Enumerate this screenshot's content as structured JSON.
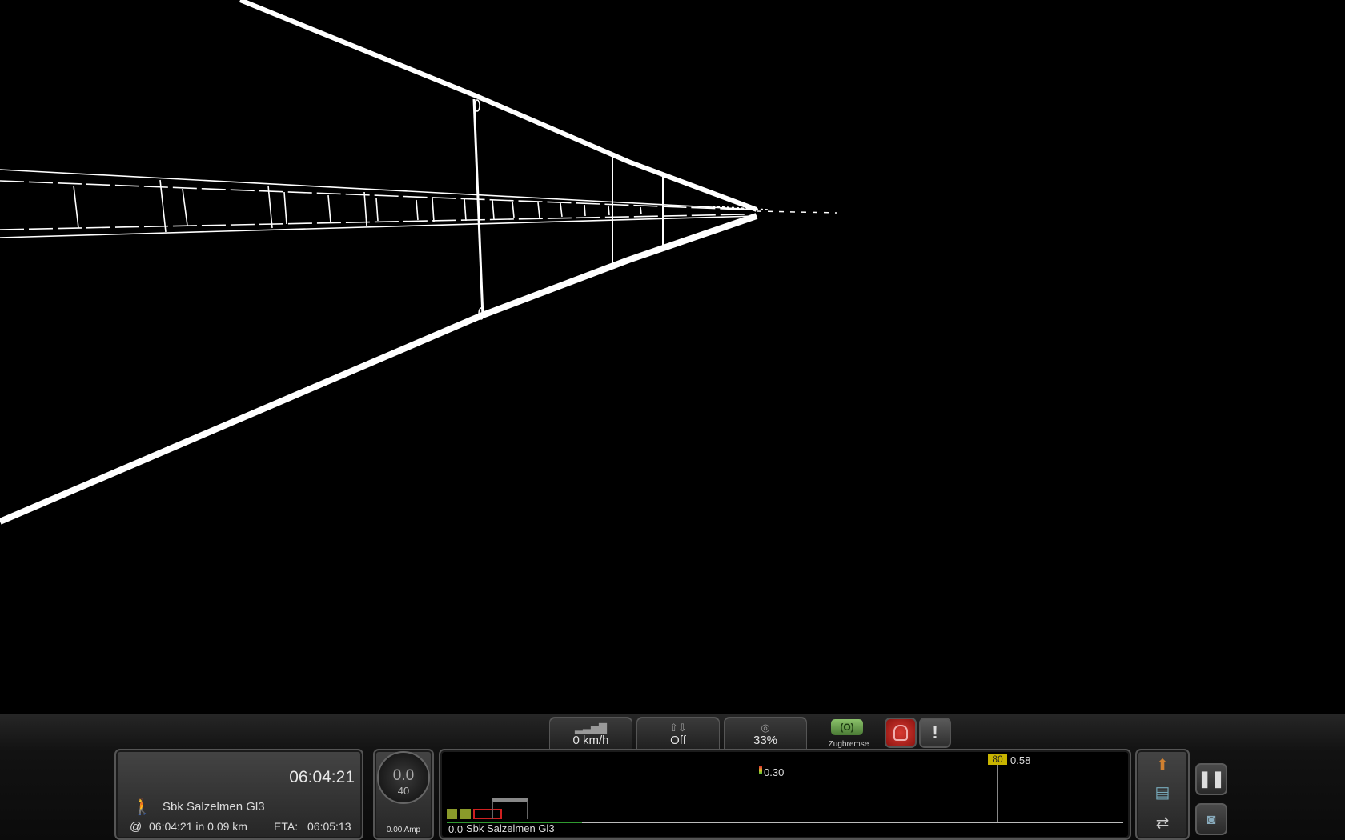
{
  "status_bar": {
    "speed_limit": {
      "icon": "signal-bars-icon",
      "label": "0 km/h"
    },
    "couple": {
      "icon": "arrows-up-down-icon",
      "label": "Off"
    },
    "throttle": {
      "icon": "gauge-icon",
      "label": "33%"
    },
    "brake": {
      "icon": "train-brake-icon",
      "label": "Zugbremse"
    },
    "emergency": {
      "icon": "hand-stop-icon",
      "color": "#c0201d"
    },
    "alert": {
      "icon": "exclamation-icon"
    }
  },
  "info_panel": {
    "clock": "06:04:21",
    "task_icon": "walking-person-icon",
    "destination": "Sbk Salzelmen Gl3",
    "at_symbol": "@",
    "at_text": "06:04:21 in 0.09 km",
    "eta_label": "ETA:",
    "eta_value": "06:05:13"
  },
  "speedometer": {
    "speed": "0.0",
    "limit": "40",
    "amps": "0.00 Amp"
  },
  "track_view": {
    "start_distance": "0.0",
    "station_name": "Sbk Salzelmen Gl3",
    "signal_distance": "0.30",
    "speed_sign_value": "80",
    "speed_sign_distance": "0.58",
    "speed_sign_color": "#c8b400",
    "train_color": "#d02020",
    "traveled_fraction": 0.2
  },
  "side_buttons": {
    "upload": "upload-icon",
    "document": "document-icon",
    "switch": "switch-arrows-icon",
    "pause": "pause-icon",
    "camera": "camera-icon"
  }
}
